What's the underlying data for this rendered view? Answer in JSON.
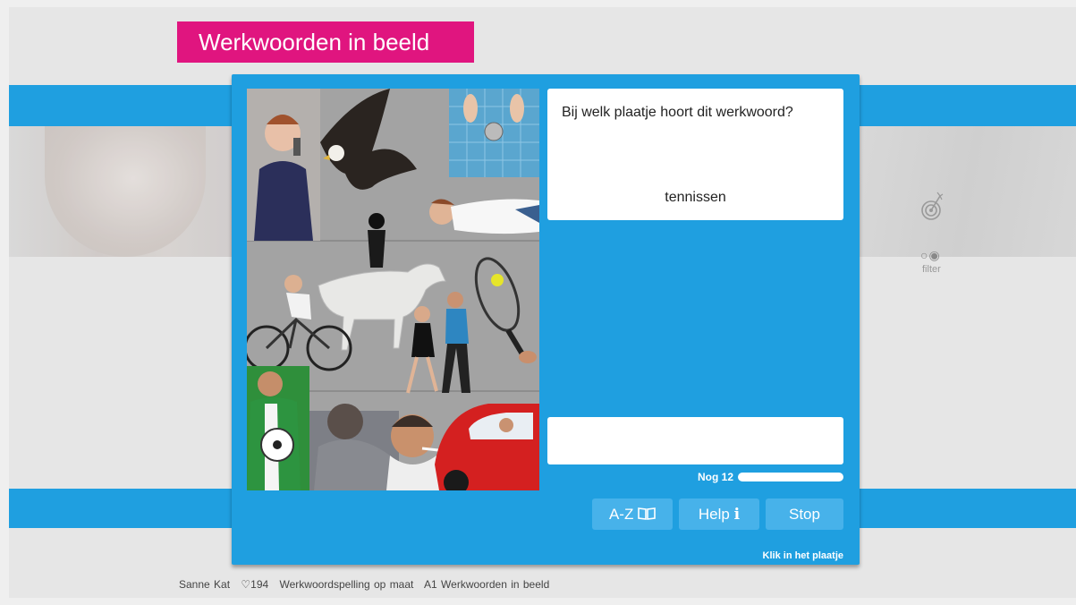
{
  "app": {
    "title": "Werkwoorden in beeld"
  },
  "question": {
    "prompt": "Bij welk plaatje hoort dit werkwoord?",
    "word": "tennissen"
  },
  "answer": {
    "value": ""
  },
  "progress": {
    "label": "Nog 12",
    "fraction": 1.0
  },
  "buttons": {
    "az": "A-Z",
    "help": "Help",
    "help_glyph": "i",
    "stop": "Stop"
  },
  "hint": "Klik in het plaatje",
  "filter": {
    "label": "filter",
    "icon": "target-icon"
  },
  "footer": {
    "user": "Sanne Kat",
    "score": "♡194",
    "course": "Werkwoordspelling op maat",
    "lesson": "A1 Werkwoorden in beeld"
  },
  "colors": {
    "accent": "#1f9fe0",
    "brand": "#e0157f",
    "button": "#47b2ea"
  },
  "picture": {
    "scenes": [
      "telefoneren",
      "vliegen",
      "douchen",
      "liggen",
      "paardrijden",
      "fietsen",
      "dansen",
      "tennissen",
      "voetballen",
      "schrijven",
      "roken",
      "autorijden"
    ]
  }
}
